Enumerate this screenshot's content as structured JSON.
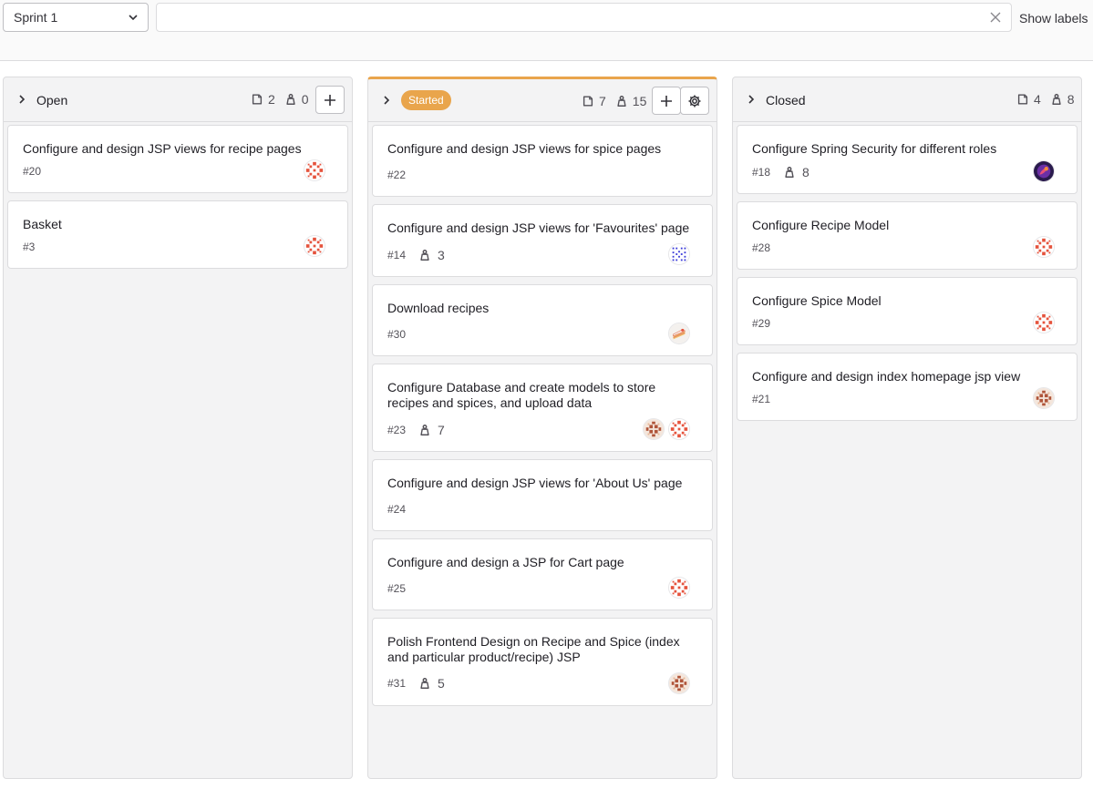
{
  "toolbar": {
    "sprint_select": "Sprint 1",
    "search_value": "",
    "show_labels": "Show labels"
  },
  "columns": {
    "open": {
      "title": "Open",
      "issue_count": "2",
      "weight_total": "0"
    },
    "started": {
      "title": "Started",
      "issue_count": "7",
      "weight_total": "15"
    },
    "closed": {
      "title": "Closed",
      "issue_count": "4",
      "weight_total": "8"
    }
  },
  "cards": {
    "open": [
      {
        "title": "Configure and design JSP views for recipe pages",
        "id": "#20",
        "avatars": [
          "avatar-red-pattern"
        ]
      },
      {
        "title": "Basket",
        "id": "#3",
        "avatars": [
          "avatar-red-pattern"
        ]
      }
    ],
    "started": [
      {
        "title": "Configure and design JSP views for spice pages",
        "id": "#22",
        "avatars": []
      },
      {
        "title": "Configure and design JSP views for 'Favourites' page",
        "id": "#14",
        "weight": "3",
        "avatars": [
          "avatar-blue-pattern"
        ]
      },
      {
        "title": "Download recipes",
        "id": "#30",
        "avatars": [
          "avatar-cake"
        ]
      },
      {
        "title": "Configure Database and create models to store recipes and spices, and upload data",
        "id": "#23",
        "weight": "7",
        "avatars": [
          "avatar-brown-pattern",
          "avatar-red-pattern"
        ]
      },
      {
        "title": "Configure and design JSP views for 'About Us' page",
        "id": "#24",
        "avatars": []
      },
      {
        "title": "Configure and design a JSP for Cart page",
        "id": "#25",
        "avatars": [
          "avatar-red-pattern"
        ]
      },
      {
        "title": "Polish Frontend Design on Recipe and Spice (index and particular product/recipe) JSP",
        "id": "#31",
        "weight": "5",
        "avatars": [
          "avatar-brown-pattern"
        ]
      }
    ],
    "closed": [
      {
        "title": "Configure Spring Security for different roles",
        "id": "#18",
        "weight": "8",
        "avatars": [
          "avatar-purple-photo"
        ]
      },
      {
        "title": "Configure Recipe Model",
        "id": "#28",
        "avatars": [
          "avatar-red-pattern"
        ]
      },
      {
        "title": "Configure Spice Model",
        "id": "#29",
        "avatars": [
          "avatar-red-pattern"
        ]
      },
      {
        "title": "Configure and design index homepage jsp view",
        "id": "#21",
        "avatars": [
          "avatar-brown-pattern"
        ]
      }
    ]
  },
  "colors": {
    "started_accent": "#e9a54c",
    "column_bg": "#f3f3f4",
    "border": "#dcdcde"
  }
}
